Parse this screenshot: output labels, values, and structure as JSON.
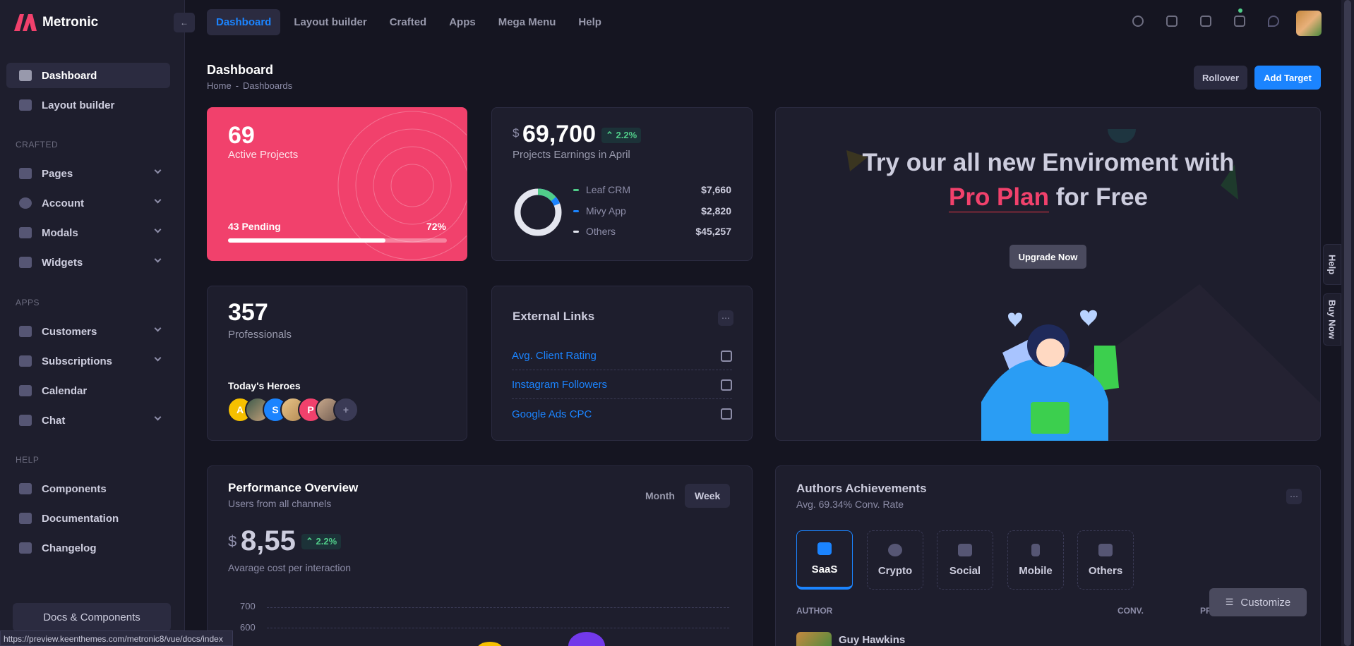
{
  "brand": {
    "name": "Metronic",
    "accent": "#1b84ff",
    "danger": "#f1416c",
    "success": "#50cd89"
  },
  "topnav": {
    "items": [
      "Dashboard",
      "Layout builder",
      "Crafted",
      "Apps",
      "Mega Menu",
      "Help"
    ],
    "active": "Dashboard"
  },
  "sidebar": {
    "top": [
      {
        "label": "Dashboard",
        "icon": "grid-icon"
      },
      {
        "label": "Layout builder",
        "icon": "toggle-icon"
      }
    ],
    "sections": [
      {
        "title": "CRAFTED",
        "items": [
          "Pages",
          "Account",
          "Modals",
          "Widgets"
        ]
      },
      {
        "title": "APPS",
        "items": [
          "Customers",
          "Subscriptions",
          "Calendar",
          "Chat"
        ]
      },
      {
        "title": "HELP",
        "items": [
          "Components",
          "Documentation",
          "Changelog"
        ]
      }
    ],
    "docs_button": "Docs & Components"
  },
  "status_url": "https://preview.keenthemes.com/metronic8/vue/docs/index",
  "page": {
    "title": "Dashboard",
    "breadcrumb": [
      "Home",
      "Dashboards"
    ],
    "rollover": "Rollover",
    "add_target": "Add Target"
  },
  "active_projects": {
    "count": "69",
    "label": "Active Projects",
    "pending": "43 Pending",
    "percent": "72%",
    "progress": 0.72
  },
  "earnings": {
    "currency": "$",
    "value": "69,700",
    "change": "2.2%",
    "label": "Projects Earnings in April",
    "legend": [
      {
        "name": "Leaf CRM",
        "value": "$7,660",
        "color": "#50cd89"
      },
      {
        "name": "Mivy App",
        "value": "$2,820",
        "color": "#1b84ff"
      },
      {
        "name": "Others",
        "value": "$45,257",
        "color": "#e4e6ef"
      }
    ]
  },
  "professionals": {
    "count": "357",
    "label": "Professionals",
    "heroes_title": "Today's Heroes",
    "heroes": [
      "A",
      "",
      "S",
      "",
      "P",
      "",
      "+"
    ]
  },
  "external_links": {
    "title": "External Links",
    "links": [
      "Avg. Client Rating",
      "Instagram Followers",
      "Google Ads CPC"
    ]
  },
  "promo": {
    "line1": "Try our all new Enviroment with",
    "highlight": "Pro Plan",
    "line2_rest": "for Free",
    "button": "Upgrade Now"
  },
  "side_tabs": [
    "Help",
    "Buy Now"
  ],
  "performance": {
    "title": "Performance Overview",
    "subtitle": "Users from all channels",
    "tabs": [
      "Month",
      "Week"
    ],
    "active_tab": "Week",
    "currency": "$",
    "value": "8,55",
    "change": "2.2%",
    "caption": "Avarage cost per interaction",
    "y_ticks": [
      "700",
      "600"
    ]
  },
  "authors": {
    "title": "Authors Achievements",
    "subtitle": "Avg. 69.34% Conv. Rate",
    "tabs": [
      "SaaS",
      "Crypto",
      "Social",
      "Mobile",
      "Others"
    ],
    "active_tab": "SaaS",
    "columns": [
      "AUTHOR",
      "CONV.",
      "PR"
    ],
    "first_row": "Guy Hawkins"
  },
  "customize": "Customize"
}
